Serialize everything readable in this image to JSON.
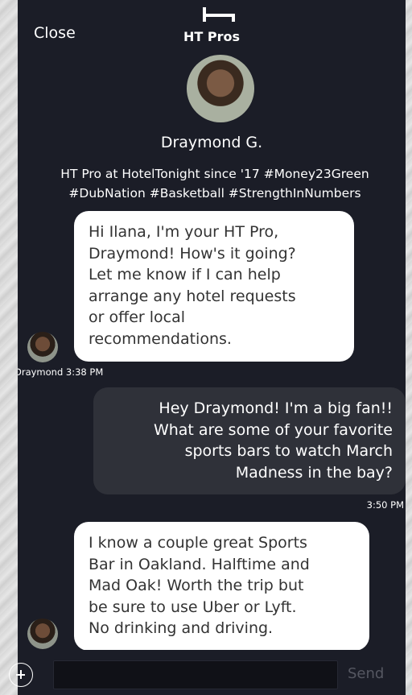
{
  "header": {
    "close_label": "Close",
    "title": "HT Pros",
    "logo_icon": "bed-icon"
  },
  "profile": {
    "name": "Draymond G.",
    "bio": "HT Pro at HotelTonight since '17 #Money23Green #DubNation #Basketball #StrengthInNumbers"
  },
  "messages": [
    {
      "sender": "pro",
      "text": "Hi Ilana, I'm your HT Pro,\nDraymond! How's it going?\nLet me know if I can help\narrange any hotel requests\nor offer local\nrecommendations.",
      "meta": "Draymond 3:38 PM"
    },
    {
      "sender": "user",
      "text": "Hey Draymond! I'm a big fan!!\nWhat are some of your favorite\nsports bars to watch March\nMadness in the bay?",
      "meta": "3:50 PM"
    },
    {
      "sender": "pro",
      "text": "I know a couple great Sports\nBar in Oakland.  Halftime and\nMad Oak! Worth the trip but\nbe sure to use Uber or Lyft.\nNo drinking and driving.",
      "meta": ""
    }
  ],
  "composer": {
    "placeholder": "",
    "send_label": "Send",
    "add_icon": "plus-circle-icon"
  },
  "colors": {
    "background": "#1b1d27",
    "incoming_bubble": "#ffffff",
    "outgoing_bubble": "#2f3139",
    "send_disabled": "#555761"
  }
}
